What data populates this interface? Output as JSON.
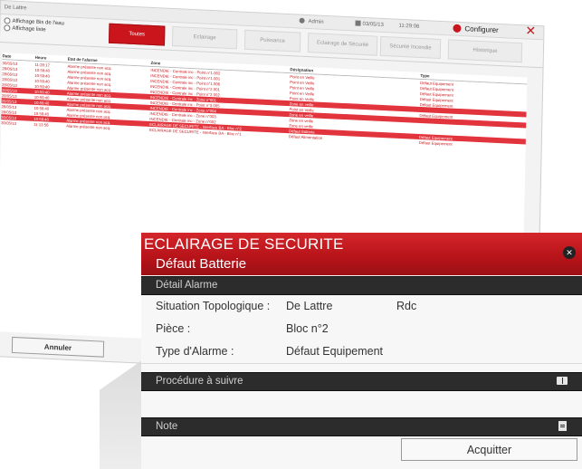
{
  "window": {
    "title": "De Lattre",
    "user": "Admin",
    "date": "03/05/13",
    "time": "11:29:06",
    "configure_label": "Configurer"
  },
  "filters": {
    "radio_1": "Affichage Bis de l'eau",
    "radio_2": "Affichage liste",
    "tabs": {
      "all": "Toutes",
      "lighting": "Eclairage",
      "power": "Puissance",
      "safety": "Eclairage de Sécurité",
      "fire": "Sécurité Incendie",
      "history": "Historique"
    }
  },
  "table": {
    "headers": {
      "date": "Date",
      "hour": "Heure",
      "state": "Etat de l'alarme",
      "zone": "Zone",
      "designation": "Désignation",
      "type": "Type"
    },
    "rows": [
      {
        "date": "30/05/13",
        "hour": "11:28:17",
        "state": "Alarme présente non acq.",
        "zone": "INCENDIE - Centrale inc - Point n°1.002",
        "designation": "Point en Veille",
        "type": "Défaut Equipement"
      },
      {
        "date": "28/05/13",
        "hour": "10:59:40",
        "state": "Alarme présente non acq.",
        "zone": "INCENDIE - Centrale inc - Point n°1.001",
        "designation": "Point en Veille",
        "type": "Défaut Equipement"
      },
      {
        "date": "28/05/13",
        "hour": "10:59:40",
        "state": "Alarme présente non acq.",
        "zone": "INCENDIE - Centrale inc - Point n°1.006",
        "designation": "Point en Veille",
        "type": "Défaut Equipement"
      },
      {
        "date": "28/05/13",
        "hour": "10:59:40",
        "state": "Alarme présente non acq.",
        "zone": "INCENDIE - Centrale inc - Point n°2.001",
        "designation": "Point en Veille",
        "type": "Défaut Equipement"
      },
      {
        "date": "28/05/13",
        "hour": "10:59:40",
        "state": "Alarme présente non acq.",
        "zone": "INCENDIE - Centrale inc - Point n°2.002",
        "designation": "Point en Veille",
        "type": "Défaut Equipement"
      },
      {
        "date": "28/05/13",
        "hour": "10:59:40",
        "state": "Alarme présente non acq.",
        "zone": "INCENDIE - Centrale inc - Zone n°001",
        "designation": "Zone en veille",
        "type": ""
      },
      {
        "date": "28/05/13",
        "hour": "10:59:40",
        "state": "Alarme présente non acq.",
        "zone": "INCENDIE - Centrale inc - Point n°3.005",
        "designation": "Point en Veille",
        "type": "Défaut Equipement"
      },
      {
        "date": "28/05/13",
        "hour": "10:59:40",
        "state": "Alarme présente non acq.",
        "zone": "INCENDIE - Centrale inc - Zone n°004",
        "designation": "Zone en veille",
        "type": ""
      },
      {
        "date": "28/05/13",
        "hour": "10:59:40",
        "state": "Alarme présente non acq.",
        "zone": "INCENDIE - Centrale inc - Zone n°003",
        "designation": "Zone en veille",
        "type": ""
      },
      {
        "date": "28/05/13",
        "hour": "10:59:40",
        "state": "Alarme présente non acq.",
        "zone": "INCENDIE - Centrale inc - Zone n°002",
        "designation": "Zone en veille",
        "type": ""
      },
      {
        "date": "30/05/13",
        "hour": "10:59:40",
        "state": "Alarme présente non acq.",
        "zone": "ECLAIRAGE DE SECURITE - Interface BA - Bloc n°2",
        "designation": "Défaut Batterie",
        "type": "Défaut Equipement"
      },
      {
        "date": "30/05/13",
        "hour": "11:13:56",
        "state": "Alarme présente non acq.",
        "zone": "ECLAIRAGE DE SECURITE - Interface BA - Bloc n°1",
        "designation": "Défaut Alimentation",
        "type": "Défaut Equipement"
      }
    ]
  },
  "cancel_label": "Annuler",
  "popup": {
    "title": "ECLAIRAGE DE SECURITE",
    "subtitle": "Défaut Batterie",
    "detail_section": "Détail Alarme",
    "details": {
      "topo_label": "Situation Topologique :",
      "topo_value": "De Lattre",
      "topo_value2": "Rdc",
      "room_label": "Pièce :",
      "room_value": "Bloc n°2",
      "type_label": "Type d'Alarme :",
      "type_value": "Défaut Equipement"
    },
    "procedure_section": "Procédure à suivre",
    "note_section": "Note",
    "acknowledge_label": "Acquitter",
    "close_glyph": "✕"
  },
  "colors": {
    "accent_red": "#c9151b",
    "section_dark": "#2c2c2c",
    "highlight_row": "#e2343c"
  }
}
